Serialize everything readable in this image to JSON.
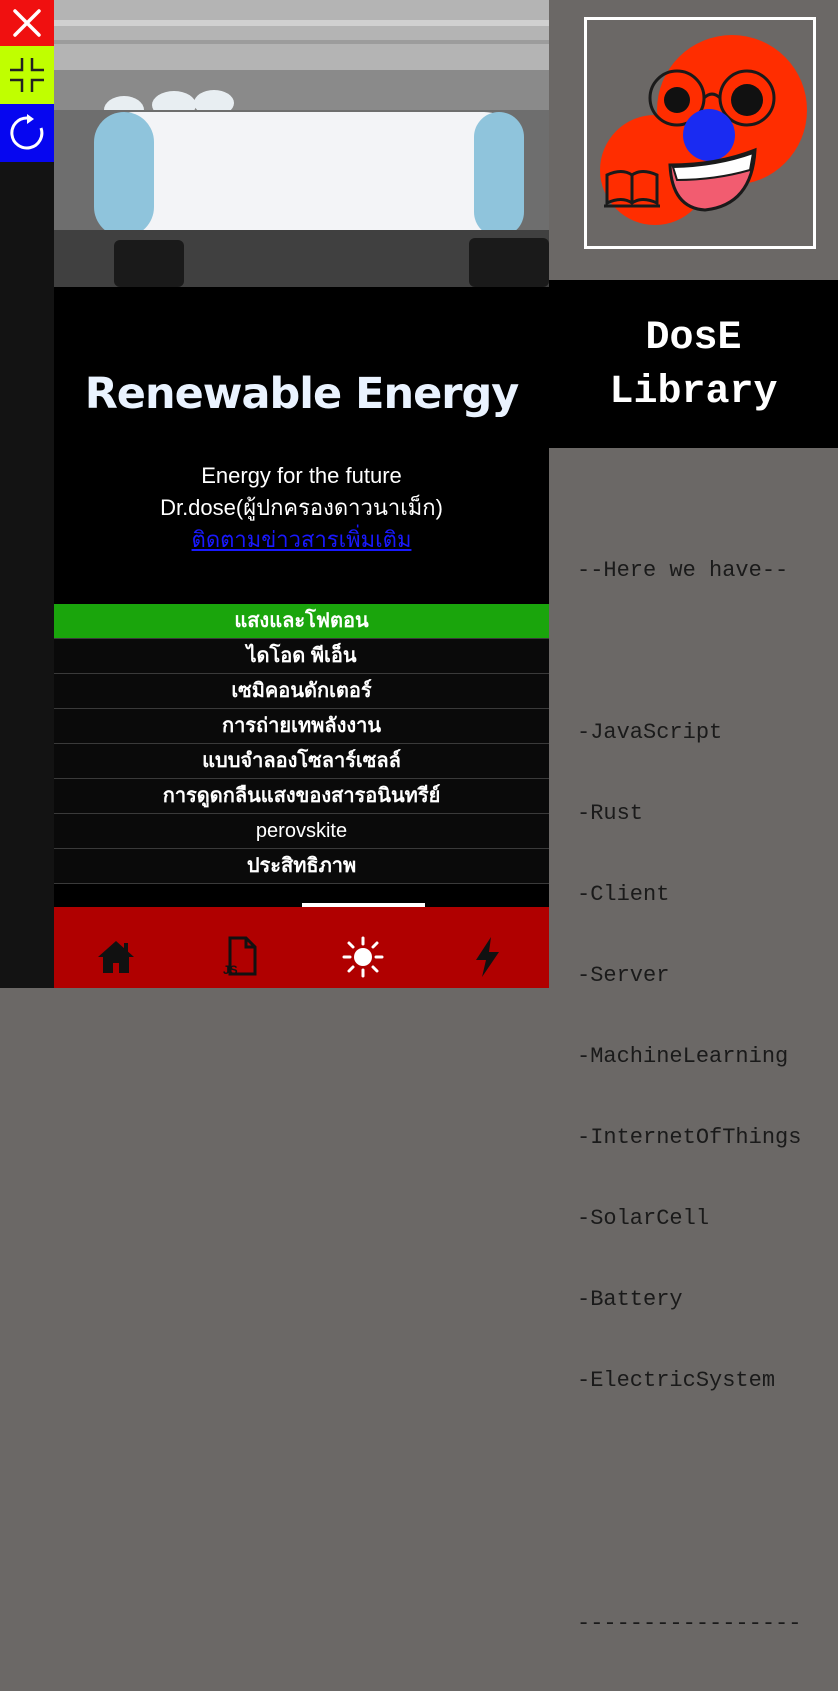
{
  "controls": {
    "close_icon": "close-icon",
    "shrink_icon": "shrink-icon",
    "reload_icon": "reload-icon",
    "colors": {
      "close": "#f01010",
      "shrink": "#c0ff00",
      "reload": "#0606f0"
    }
  },
  "hero": {
    "title": "Renewable Energy",
    "subtitle_line1": "Energy for the future",
    "subtitle_line2": "Dr.dose(ผู้ปกครองดาวนาเม็ก)",
    "link_text": "ติดตามข่าวสารเพิ่มเติม"
  },
  "menu": {
    "items": [
      {
        "label": "แสงและโฟตอน"
      },
      {
        "label": "ไดโอด พีเอ็น"
      },
      {
        "label": "เซมิคอนดักเตอร์"
      },
      {
        "label": "การถ่ายเทพลังงาน"
      },
      {
        "label": "แบบจำลองโซลาร์เซลล์"
      },
      {
        "label": "การดูดกลืนแสงของสารอนินทรีย์"
      },
      {
        "label": "perovskite"
      },
      {
        "label": "ประสิทธิภาพ"
      }
    ],
    "active_color": "#1aa50c"
  },
  "bottom_nav": {
    "icons": [
      "home-icon",
      "js-file-icon",
      "sun-icon",
      "lightning-icon"
    ],
    "js_label": "JS",
    "background": "#b00000"
  },
  "brand": {
    "line1": "DosE",
    "line2": "Library"
  },
  "library": {
    "heading": "--Here we have--",
    "items": [
      "-JavaScript",
      "-Rust",
      "-Client",
      "-Server",
      "-MachineLearning",
      "-InternetOfThings",
      "-SolarCell",
      "-Battery",
      "-ElectricSystem"
    ],
    "footer": "-----------------"
  }
}
